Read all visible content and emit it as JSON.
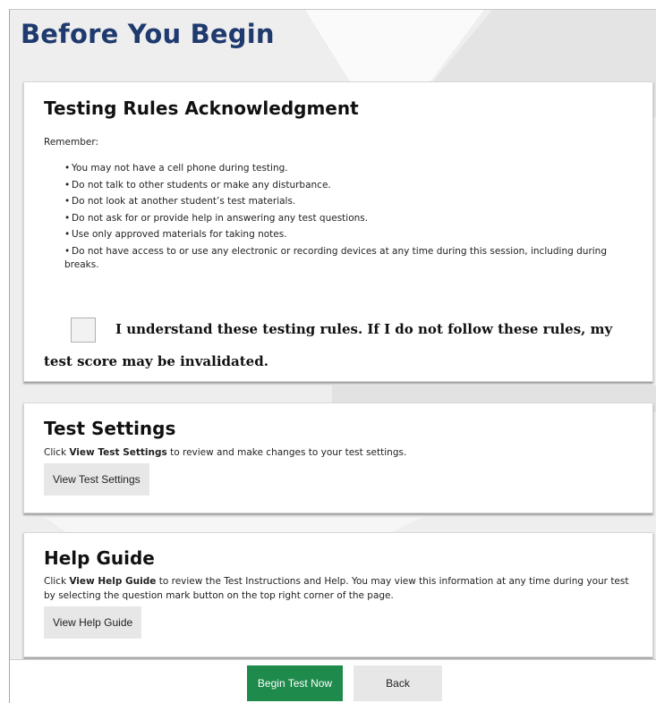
{
  "page": {
    "title": "Before You Begin"
  },
  "rules_card": {
    "title": "Testing Rules Acknowledgment",
    "remember": "Remember:",
    "rules": [
      "You may not have a cell phone during testing.",
      "Do not talk to other students or make any disturbance.",
      "Do not look at another student’s test materials.",
      "Do not ask for or provide help in answering any test questions.",
      "Use only approved materials for taking notes.",
      "Do not have access to or use any electronic or recording devices at any time during this session, including during breaks."
    ],
    "bullet": "•",
    "acknowledgment": "I understand these testing rules. If I do not follow these rules, my test score may be invalidated.",
    "checkbox_checked": false
  },
  "settings_card": {
    "title": "Test Settings",
    "desc_prefix": "Click ",
    "desc_bold": "View Test Settings",
    "desc_suffix": " to review and make changes to your test settings.",
    "button_label": "View Test Settings"
  },
  "help_card": {
    "title": "Help Guide",
    "desc_prefix": "Click ",
    "desc_bold": "View Help Guide",
    "desc_suffix": " to review the Test Instructions and Help. You may view this information at any time during your test by selecting the question mark button on the top right corner of the page.",
    "button_label": "View Help Guide"
  },
  "footer": {
    "begin_label": "Begin Test Now",
    "back_label": "Back"
  },
  "colors": {
    "title": "#1f3a6e",
    "begin_button": "#1e8a4c",
    "gray_button": "#e7e7e7"
  }
}
